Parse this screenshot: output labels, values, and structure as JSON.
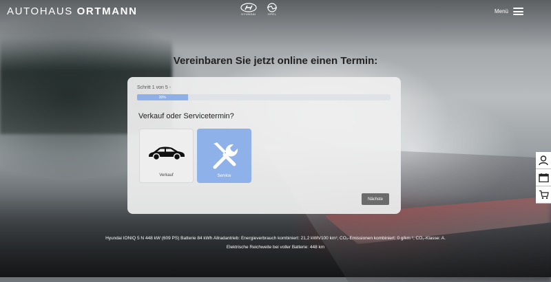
{
  "header": {
    "brand_light": "AUTOHAUS",
    "brand_bold": "ORTMANN",
    "logo_hyundai": "HYUNDAI",
    "logo_opel": "OPEL",
    "menu_label": "Menü"
  },
  "page_title": "Vereinbaren Sie jetzt online einen Termin:",
  "form": {
    "step_text": "Schritt 1 von 5 -",
    "progress": {
      "value": 20,
      "label": "20%"
    },
    "question": "Verkauf oder Servicetermin?",
    "options": [
      {
        "label": "Verkauf",
        "icon": "car-icon",
        "selected": false
      },
      {
        "label": "Service",
        "icon": "tools-icon",
        "selected": true
      }
    ],
    "next_label": "Nächste"
  },
  "footer": {
    "line1": "Hyundai IONIQ 5 N 448 kW (609 PS) Batterie 84 kWh Allradantrieb: Energieverbrauch kombiniert: 21,2 kWh/100 km¹; CO₂-Emissionen kombiniert: 0 g/km ¹; CO₂-Klasse: A.",
    "line2": "Elektrische Reichweite bei voller Batterie: 448 km"
  },
  "sidebar": [
    "user-icon",
    "calendar-icon",
    "cart-icon"
  ],
  "colors": {
    "accent": "#8fb1e9",
    "button": "#6b6b6b",
    "card": "#eeeeee"
  }
}
